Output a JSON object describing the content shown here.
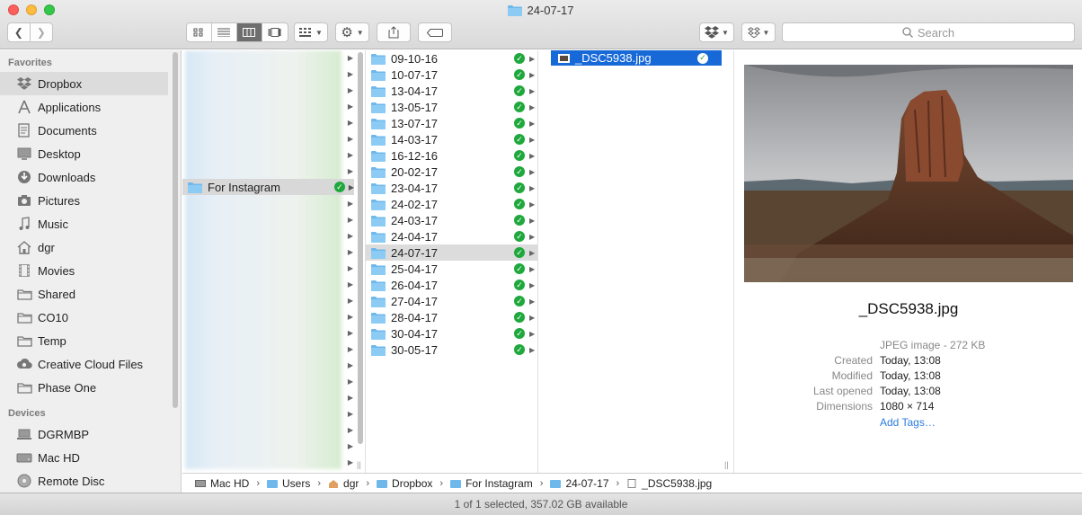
{
  "window": {
    "title": "24-07-17"
  },
  "toolbar": {
    "search_placeholder": "Search"
  },
  "sidebar": {
    "favorites_header": "Favorites",
    "favorites": [
      {
        "label": "Dropbox",
        "icon": "dropbox-icon",
        "selected": true
      },
      {
        "label": "Applications",
        "icon": "applications-icon"
      },
      {
        "label": "Documents",
        "icon": "documents-icon"
      },
      {
        "label": "Desktop",
        "icon": "desktop-icon"
      },
      {
        "label": "Downloads",
        "icon": "downloads-icon"
      },
      {
        "label": "Pictures",
        "icon": "pictures-icon"
      },
      {
        "label": "Music",
        "icon": "music-icon"
      },
      {
        "label": "dgr",
        "icon": "home-icon"
      },
      {
        "label": "Movies",
        "icon": "movies-icon"
      },
      {
        "label": "Shared",
        "icon": "folder-icon"
      },
      {
        "label": "CO10",
        "icon": "folder-icon"
      },
      {
        "label": "Temp",
        "icon": "folder-icon"
      },
      {
        "label": "Creative Cloud Files",
        "icon": "creative-cloud-icon"
      },
      {
        "label": "Phase One",
        "icon": "folder-icon"
      }
    ],
    "devices_header": "Devices",
    "devices": [
      {
        "label": "DGRMBP",
        "icon": "laptop-icon"
      },
      {
        "label": "Mac HD",
        "icon": "disk-icon"
      },
      {
        "label": "Remote Disc",
        "icon": "disc-icon"
      }
    ]
  },
  "column1": {
    "selected_label": "For Instagram"
  },
  "column2": {
    "items": [
      "09-10-16",
      "10-07-17",
      "13-04-17",
      "13-05-17",
      "13-07-17",
      "14-03-17",
      "16-12-16",
      "20-02-17",
      "23-04-17",
      "24-02-17",
      "24-03-17",
      "24-04-17",
      "24-07-17",
      "25-04-17",
      "26-04-17",
      "27-04-17",
      "28-04-17",
      "30-04-17",
      "30-05-17"
    ],
    "selected": "24-07-17"
  },
  "column3": {
    "file": "_DSC5938.jpg"
  },
  "preview": {
    "name": "_DSC5938.jpg",
    "kind": "JPEG image - 272 KB",
    "fields": [
      {
        "key": "Created",
        "value": "Today, 13:08"
      },
      {
        "key": "Modified",
        "value": "Today, 13:08"
      },
      {
        "key": "Last opened",
        "value": "Today, 13:08"
      },
      {
        "key": "Dimensions",
        "value": "1080 × 714"
      }
    ],
    "add_tags": "Add Tags…"
  },
  "pathbar": [
    "Mac HD",
    "Users",
    "dgr",
    "Dropbox",
    "For Instagram",
    "24-07-17",
    "_DSC5938.jpg"
  ],
  "status": "1 of 1 selected, 357.02 GB available",
  "colors": {
    "accent": "#1769d8",
    "sync_green": "#1fa83c",
    "folder_blue": "#6fb8ec"
  }
}
